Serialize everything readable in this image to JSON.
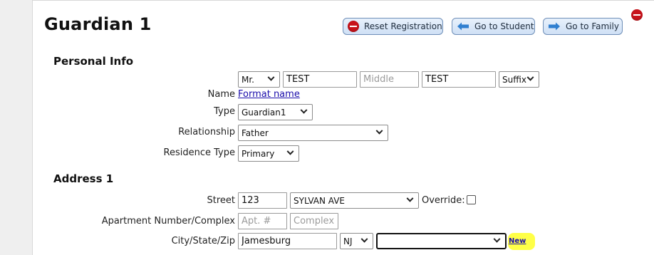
{
  "header": {
    "title": "Guardian 1",
    "buttons": {
      "reset": "Reset Registration",
      "student": "Go to Student",
      "family": "Go to Family"
    }
  },
  "personal": {
    "section_title": "Personal Info",
    "prefix": "Mr.",
    "first": "TEST",
    "middle_placeholder": "Middle",
    "last": "TEST",
    "suffix": "Suffix",
    "name_label": "Name",
    "format_link": "Format name",
    "type_label": "Type",
    "type_value": "Guardian1",
    "relationship_label": "Relationship",
    "relationship_value": "Father",
    "residence_label": "Residence Type",
    "residence_value": "Primary"
  },
  "address": {
    "section_title": "Address 1",
    "street_label": "Street",
    "street_number": "123",
    "street_name": "SYLVAN AVE",
    "override_label": "Override:",
    "apt_label": "Apartment Number/Complex",
    "apt_placeholder": "Apt. #",
    "complex_placeholder": "Complex",
    "csz_label": "City/State/Zip",
    "city": "Jamesburg",
    "state": "NJ",
    "zip": "",
    "new_link": "New"
  },
  "colors": {
    "button_border": "#6f8fb8",
    "arrow_blue": "#2f7fd0",
    "stop_red": "#c8131b",
    "highlight": "#ffff33"
  }
}
